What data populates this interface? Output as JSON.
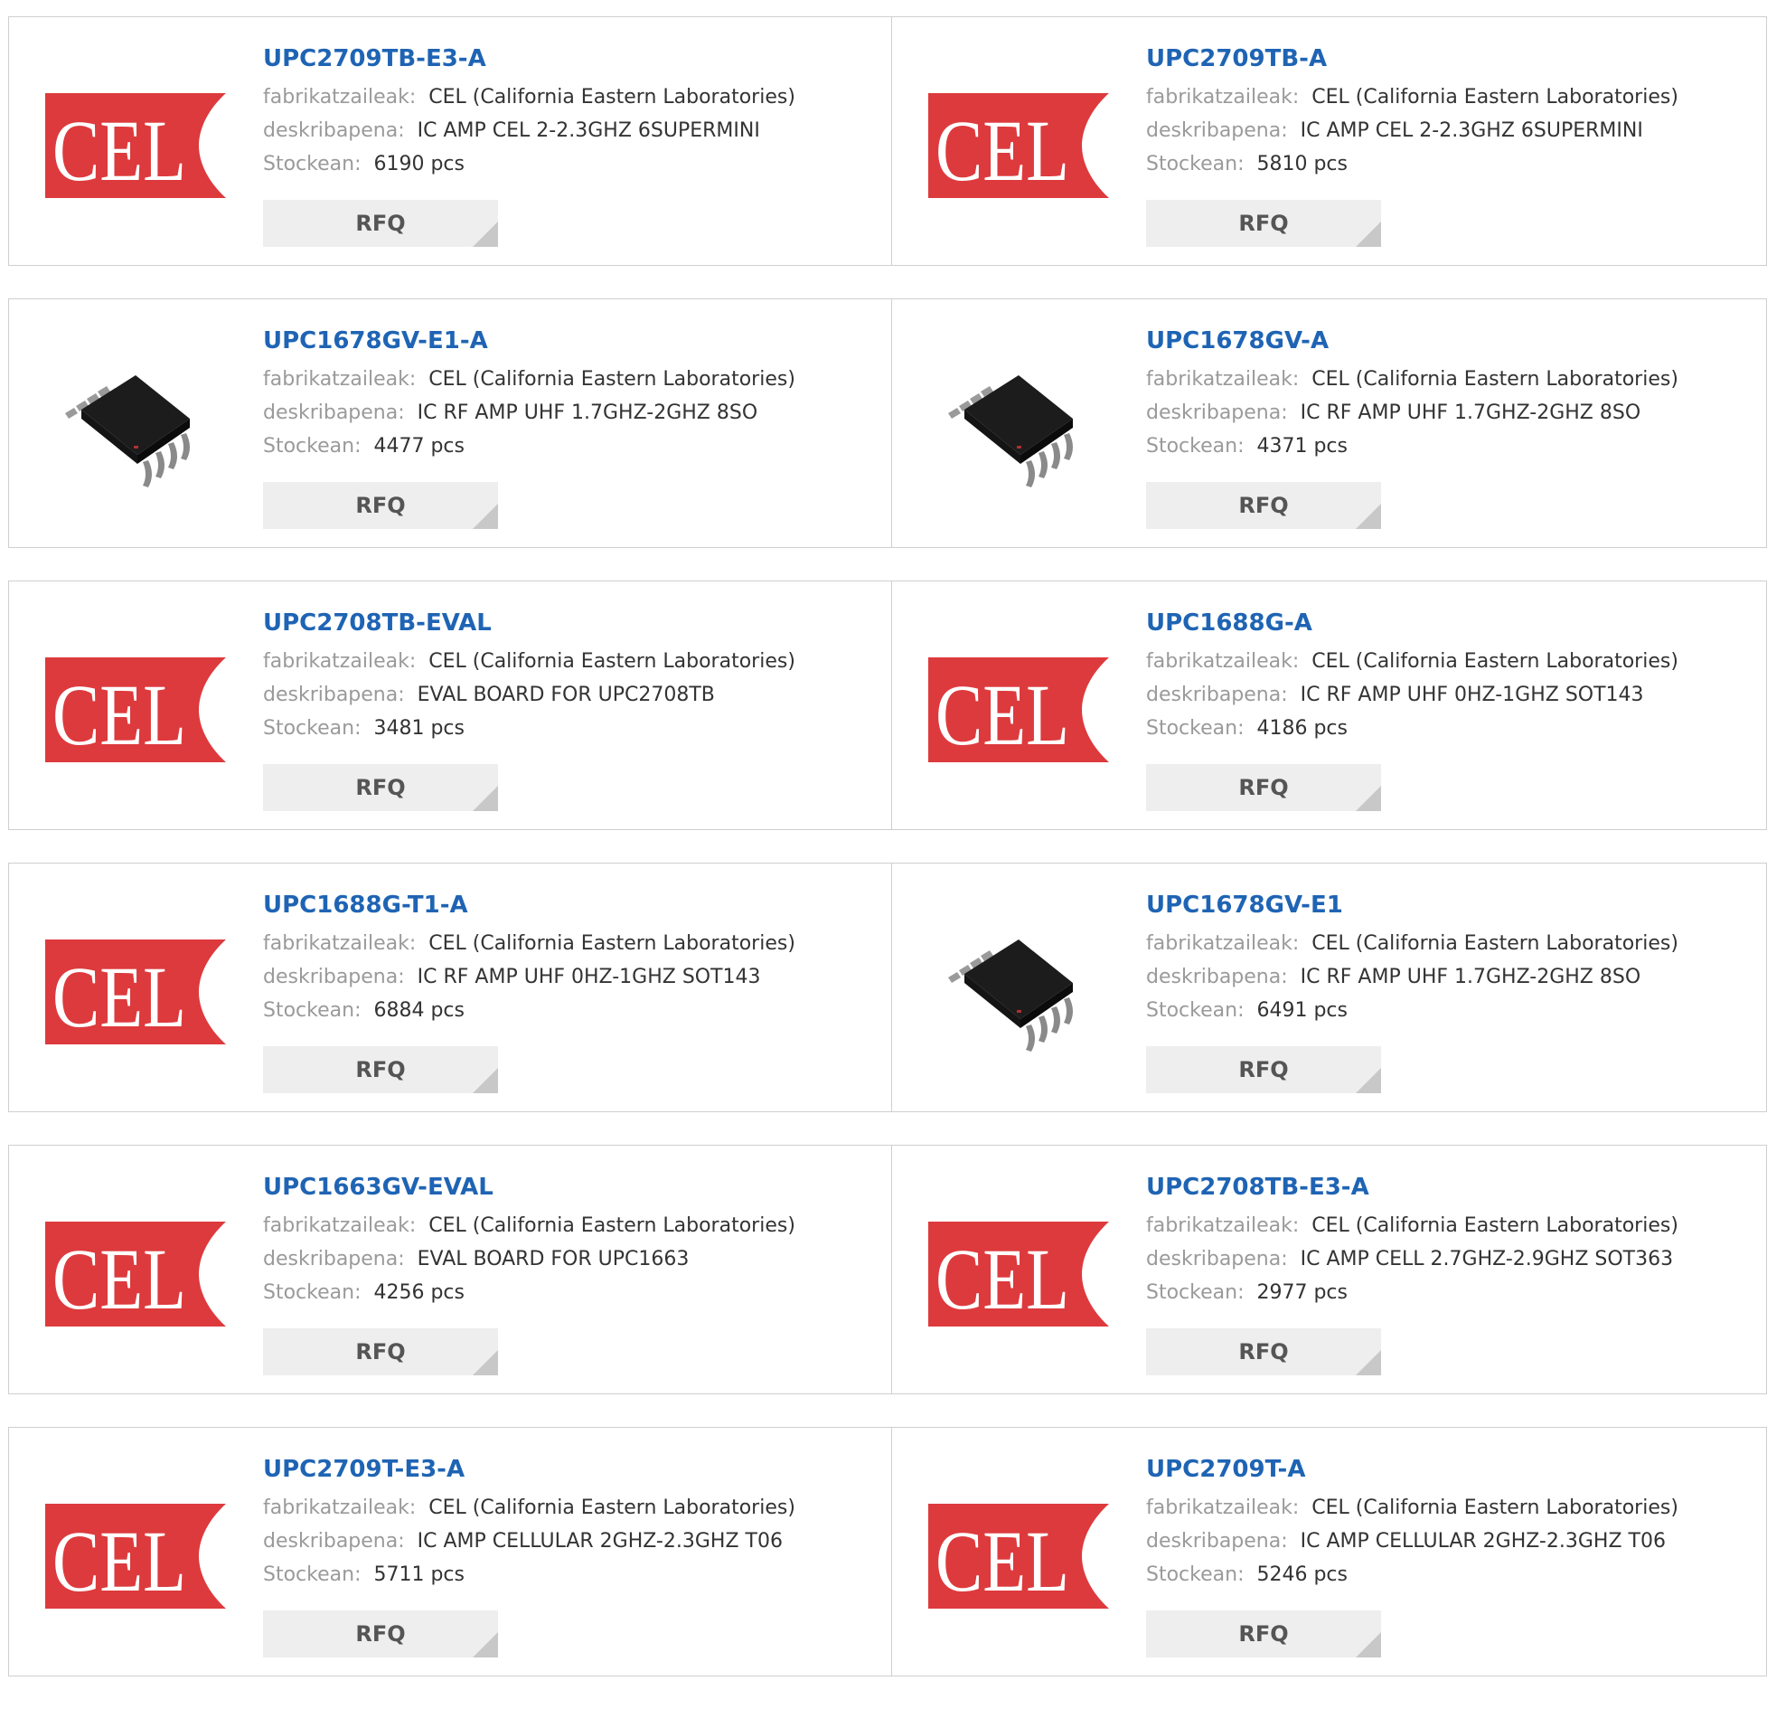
{
  "labels": {
    "manufacturer": "fabrikatzaileak:",
    "description": "deskribapena:",
    "stock": "Stockean:",
    "rfq": "RFQ"
  },
  "brand": {
    "logo_text": "CEL",
    "logo_color": "#dd3a3d",
    "link_color": "#1f64b4"
  },
  "products": [
    {
      "part": "UPC2709TB-E3-A",
      "manufacturer": "CEL (California Eastern Laboratories)",
      "description": "IC AMP CEL 2-2.3GHZ 6SUPERMINI",
      "stock": "6190 pcs",
      "image": "cel-logo"
    },
    {
      "part": "UPC2709TB-A",
      "manufacturer": "CEL (California Eastern Laboratories)",
      "description": "IC AMP CEL 2-2.3GHZ 6SUPERMINI",
      "stock": "5810 pcs",
      "image": "cel-logo"
    },
    {
      "part": "UPC1678GV-E1-A",
      "manufacturer": "CEL (California Eastern Laboratories)",
      "description": "IC RF AMP UHF 1.7GHZ-2GHZ 8SO",
      "stock": "4477 pcs",
      "image": "chip-8so"
    },
    {
      "part": "UPC1678GV-A",
      "manufacturer": "CEL (California Eastern Laboratories)",
      "description": "IC RF AMP UHF 1.7GHZ-2GHZ 8SO",
      "stock": "4371 pcs",
      "image": "chip-8so"
    },
    {
      "part": "UPC2708TB-EVAL",
      "manufacturer": "CEL (California Eastern Laboratories)",
      "description": "EVAL BOARD FOR UPC2708TB",
      "stock": "3481 pcs",
      "image": "cel-logo"
    },
    {
      "part": "UPC1688G-A",
      "manufacturer": "CEL (California Eastern Laboratories)",
      "description": "IC RF AMP UHF 0HZ-1GHZ SOT143",
      "stock": "4186 pcs",
      "image": "cel-logo"
    },
    {
      "part": "UPC1688G-T1-A",
      "manufacturer": "CEL (California Eastern Laboratories)",
      "description": "IC RF AMP UHF 0HZ-1GHZ SOT143",
      "stock": "6884 pcs",
      "image": "cel-logo"
    },
    {
      "part": "UPC1678GV-E1",
      "manufacturer": "CEL (California Eastern Laboratories)",
      "description": "IC RF AMP UHF 1.7GHZ-2GHZ 8SO",
      "stock": "6491 pcs",
      "image": "chip-8so"
    },
    {
      "part": "UPC1663GV-EVAL",
      "manufacturer": "CEL (California Eastern Laboratories)",
      "description": "EVAL BOARD FOR UPC1663",
      "stock": "4256 pcs",
      "image": "cel-logo"
    },
    {
      "part": "UPC2708TB-E3-A",
      "manufacturer": "CEL (California Eastern Laboratories)",
      "description": "IC AMP CELL 2.7GHZ-2.9GHZ SOT363",
      "stock": "2977 pcs",
      "image": "cel-logo"
    },
    {
      "part": "UPC2709T-E3-A",
      "manufacturer": "CEL (California Eastern Laboratories)",
      "description": "IC AMP CELLULAR 2GHZ-2.3GHZ T06",
      "stock": "5711 pcs",
      "image": "cel-logo"
    },
    {
      "part": "UPC2709T-A",
      "manufacturer": "CEL (California Eastern Laboratories)",
      "description": "IC AMP CELLULAR 2GHZ-2.3GHZ T06",
      "stock": "5246 pcs",
      "image": "cel-logo"
    }
  ]
}
